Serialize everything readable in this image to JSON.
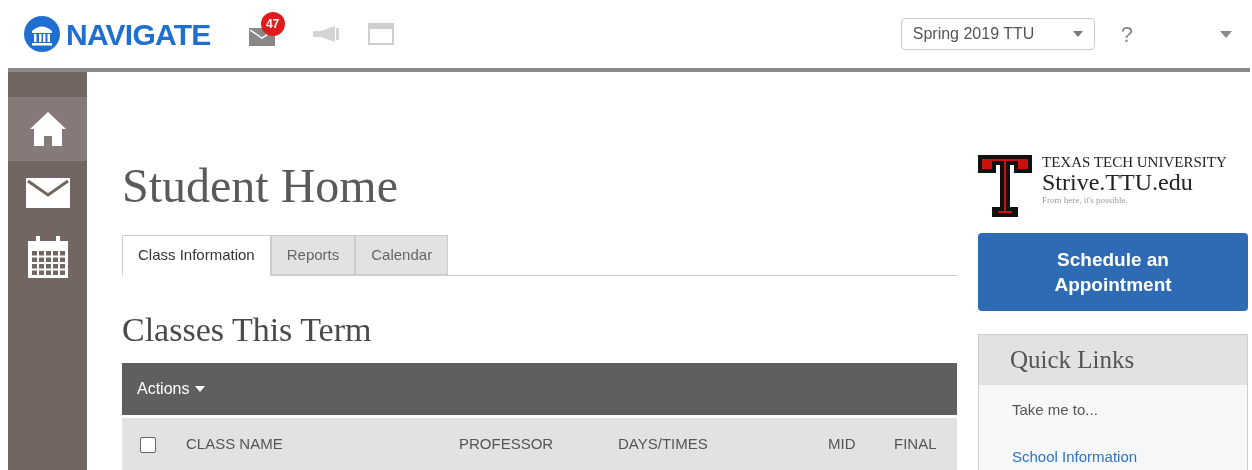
{
  "header": {
    "brand": "NAVIGATE",
    "message_count": "47",
    "term": "Spring 2019 TTU",
    "help": "?"
  },
  "sidebar": {
    "items": [
      {
        "kind": "home",
        "selected": true
      },
      {
        "kind": "mail",
        "selected": false
      },
      {
        "kind": "calendar",
        "selected": false
      }
    ]
  },
  "page_title": "Student Home",
  "tabs": [
    {
      "label": "Class Information",
      "selected": true
    },
    {
      "label": "Reports",
      "selected": false
    },
    {
      "label": "Calendar",
      "selected": false
    }
  ],
  "section_title": "Classes This Term",
  "table": {
    "actions": "Actions",
    "select_all_checked": false,
    "columns": [
      "CLASS NAME",
      "PROFESSOR",
      "DAYS/TIMES",
      "MID",
      "FINAL"
    ]
  },
  "school_logo": {
    "name": "TEXAS TECH UNIVERSITY",
    "site": "Strive.TTU.edu",
    "tagline": "From here, it's possible."
  },
  "schedule_button": "Schedule an Appointment",
  "quick_links": {
    "title": "Quick Links",
    "intro": "Take me to...",
    "links": [
      "School Information"
    ]
  }
}
